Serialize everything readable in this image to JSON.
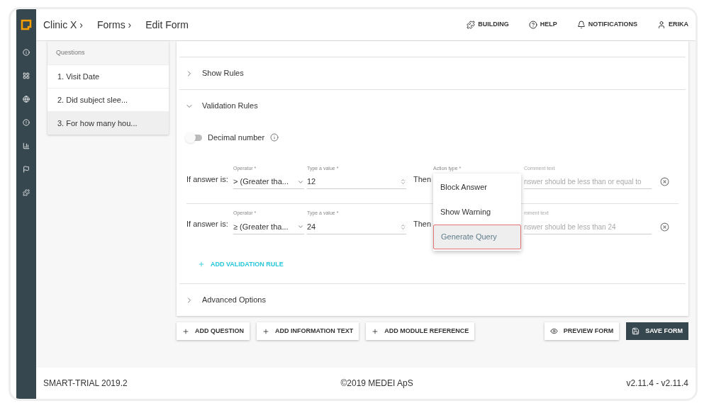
{
  "breadcrumbs": [
    "Clinic X ›",
    "Forms ›",
    "Edit Form"
  ],
  "header_actions": [
    {
      "label": "BUILDING"
    },
    {
      "label": "HELP"
    },
    {
      "label": "NOTIFICATIONS"
    },
    {
      "label": "ERIKA"
    }
  ],
  "sidebar": {
    "items": [
      {
        "selected": false
      },
      {
        "selected": false
      },
      {
        "selected": false
      },
      {
        "selected": false
      },
      {
        "selected": false
      },
      {
        "selected": false
      },
      {
        "selected": false
      }
    ]
  },
  "questions": {
    "title": "Questions",
    "items": [
      {
        "label": "1. Visit Date",
        "selected": false
      },
      {
        "label": "2. Did subject slee...",
        "selected": false
      },
      {
        "label": "3. For how many hou...",
        "selected": true
      }
    ]
  },
  "sections": [
    {
      "title": "Show Rules",
      "expanded": false
    },
    {
      "title": "Validation Rules",
      "expanded": true
    }
  ],
  "decimal": {
    "label": "Decimal number",
    "on": false
  },
  "rules": [
    {
      "prefix": "If answer is:",
      "operator_label": "Operator *",
      "operator": "> (Greater tha...",
      "value_label": "Type a value *",
      "value": "12",
      "then": "Then",
      "action_label": "Action type *",
      "comment_label": "Comment text",
      "comment": "nswer should be less than or equal to"
    },
    {
      "prefix": "If answer is:",
      "operator_label": "Operator *",
      "operator": "≥ (Greater tha...",
      "value_label": "Type a value *",
      "value": "24",
      "then": "Then",
      "comment_label": "mment text",
      "comment": "nswer should be less than 24"
    }
  ],
  "action_menu": [
    {
      "label": "Block Answer",
      "selected": false
    },
    {
      "label": "Show Warning",
      "selected": false
    },
    {
      "label": "Generate Query",
      "selected": true
    }
  ],
  "add_rule": "ADD VALIDATION RULE",
  "advanced": {
    "title": "Advanced Options",
    "expanded": false
  },
  "bottom_buttons": [
    {
      "label": "ADD QUESTION"
    },
    {
      "label": "ADD INFORMATION TEXT"
    },
    {
      "label": "ADD MODULE REFERENCE"
    }
  ],
  "preview_button": "PREVIEW FORM",
  "save_button": "SAVE FORM",
  "footer": {
    "product": "SMART-TRIAL 2019.2",
    "copyright": "©2019 MEDEI ApS",
    "version": "v2.11.4 - v2.11.4"
  }
}
